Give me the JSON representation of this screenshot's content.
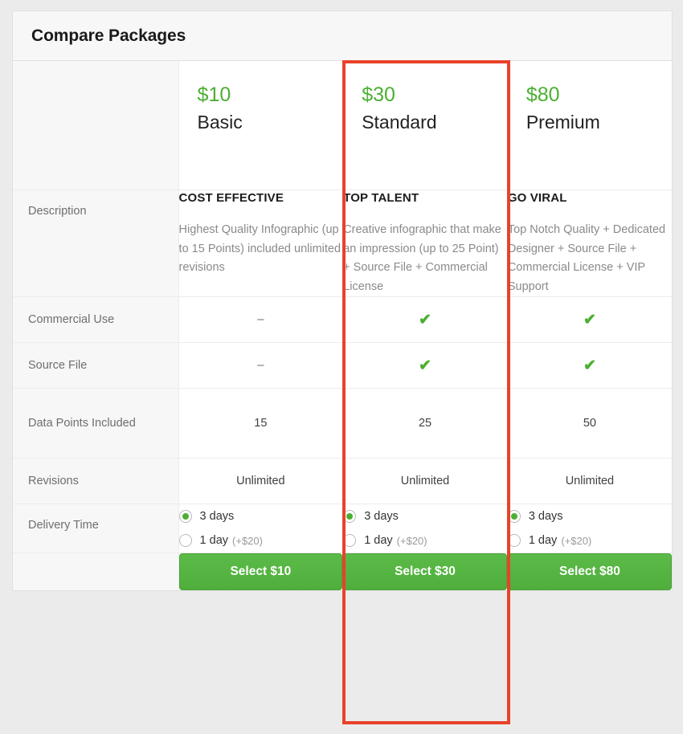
{
  "header": {
    "title": "Compare Packages"
  },
  "plans": [
    {
      "price": "$10",
      "name": "Basic",
      "select_label": "Select $10"
    },
    {
      "price": "$30",
      "name": "Standard",
      "select_label": "Select $30"
    },
    {
      "price": "$80",
      "name": "Premium",
      "select_label": "Select $80"
    }
  ],
  "rows": {
    "description": {
      "label": "Description",
      "values": [
        {
          "title": "COST EFFECTIVE",
          "body": "Highest Quality Infographic (up to 15 Points) included unlimited revisions"
        },
        {
          "title": "TOP TALENT",
          "body": "Creative infographic that make an impression (up to 25 Point) + Source File + Commercial License"
        },
        {
          "title": "GO VIRAL",
          "body": "Top Notch Quality + Dedicated Designer + Source File + Commercial License + VIP Support"
        }
      ]
    },
    "commercial_use": {
      "label": "Commercial Use",
      "values": [
        "–",
        "✔",
        "✔"
      ],
      "included": [
        false,
        true,
        true
      ]
    },
    "source_file": {
      "label": "Source File",
      "values": [
        "–",
        "✔",
        "✔"
      ],
      "included": [
        false,
        true,
        true
      ]
    },
    "data_points": {
      "label": "Data Points Included",
      "values": [
        "15",
        "25",
        "50"
      ]
    },
    "revisions": {
      "label": "Revisions",
      "values": [
        "Unlimited",
        "Unlimited",
        "Unlimited"
      ]
    },
    "delivery_time": {
      "label": "Delivery Time",
      "options": [
        {
          "label": "3 days",
          "extra": "",
          "selected": true
        },
        {
          "label": "1 day",
          "extra": "(+$20)",
          "selected": false
        }
      ]
    }
  },
  "highlight": {
    "target_plan": "Standard",
    "color": "#e8422a"
  },
  "colors": {
    "price_green": "#4caf33",
    "button_green": "#56b544",
    "highlight_red": "#e8422a"
  }
}
